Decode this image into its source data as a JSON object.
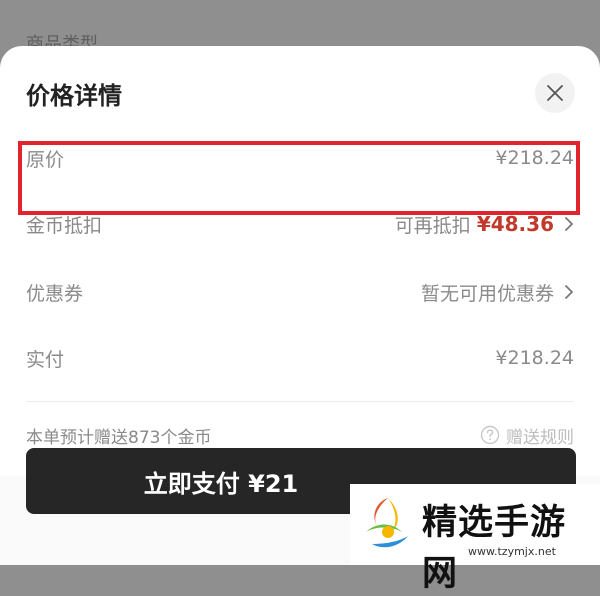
{
  "background": {
    "label": "商品类型"
  },
  "sheet": {
    "title": "价格详情",
    "rows": [
      {
        "label": "原价",
        "value": "¥218.24"
      },
      {
        "label": "金币抵扣",
        "prefix": "可再抵扣",
        "value": "¥48.36"
      },
      {
        "label": "优惠券",
        "value": "暂无可用优惠券"
      },
      {
        "label": "实付",
        "value": "¥218.24"
      }
    ],
    "gift_text": "本单预计赠送873个金币",
    "rules_label": "赠送规则"
  },
  "footer": {
    "pay_label": "立即支付 ¥21"
  },
  "watermark": {
    "title": "精选手游网",
    "url": "www.tzymjx.net"
  },
  "colors": {
    "highlight": "#e1242d",
    "deduct": "#c0392b",
    "pay_button": "#262626"
  }
}
